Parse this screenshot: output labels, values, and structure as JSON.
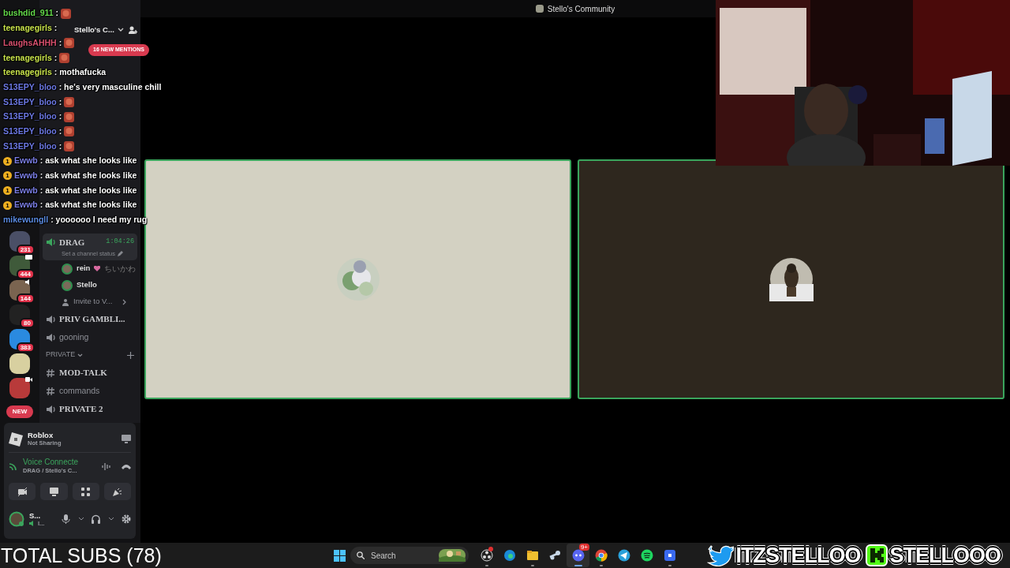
{
  "title_bar": {
    "title": "Stello's Community"
  },
  "server_header": {
    "name": "Stello's C...",
    "mentions": "16 NEW MENTIONS"
  },
  "chat": [
    {
      "user": "bushdid_911",
      "color": "#63d84a",
      "message": ":",
      "emote": true
    },
    {
      "user": "teenagegirls",
      "color": "#c6e04a",
      "message": ":"
    },
    {
      "user": "LaughsAHHH",
      "color": "#d8506e",
      "message": ":",
      "emote": true
    },
    {
      "user": "teenagegirls",
      "color": "#c6e04a",
      "message": ":",
      "emote": true
    },
    {
      "user": "teenagegirls",
      "color": "#c6e04a",
      "message": ": mothafucka"
    },
    {
      "user": "S13EPY_bloo",
      "color": "#6c78e4",
      "message": ": he's very masculine chill"
    },
    {
      "user": "S13EPY_bloo",
      "color": "#6c78e4",
      "message": ":",
      "emote": true
    },
    {
      "user": "S13EPY_bloo",
      "color": "#6c78e4",
      "message": ":",
      "emote": true
    },
    {
      "user": "S13EPY_bloo",
      "color": "#6c78e4",
      "message": ":",
      "emote": true
    },
    {
      "user": "S13EPY_bloo",
      "color": "#6c78e4",
      "message": ":",
      "emote": true
    },
    {
      "user": "Ewwb",
      "color": "#7b7ee6",
      "badge": "1",
      "message": ": ask what she looks like"
    },
    {
      "user": "Ewwb",
      "color": "#7b7ee6",
      "badge": "1",
      "message": ": ask what she looks like"
    },
    {
      "user": "Ewwb",
      "color": "#7b7ee6",
      "badge": "1",
      "message": ": ask what she looks like"
    },
    {
      "user": "Ewwb",
      "color": "#7b7ee6",
      "badge": "1",
      "message": ": ask what she looks like"
    },
    {
      "user": "mikewungll",
      "color": "#5a8ae0",
      "message": ": yoooooo I need my rug"
    }
  ],
  "server_rail": [
    {
      "color": "#4a4f66",
      "badge": "231",
      "screen_sharing": false,
      "in_voice": false,
      "camera_on": false
    },
    {
      "color": "#3f5a3a",
      "badge": "444",
      "screen_sharing": true,
      "in_voice": false,
      "camera_on": false
    },
    {
      "color": "#7a6450",
      "badge": "144",
      "screen_sharing": false,
      "in_voice": true,
      "camera_on": false
    },
    {
      "color": "#222222",
      "badge": "80",
      "screen_sharing": false,
      "in_voice": false,
      "camera_on": false
    },
    {
      "color": "#2a8ae0",
      "badge": "383",
      "screen_sharing": false,
      "in_voice": false,
      "camera_on": false
    },
    {
      "color": "#d8d0a0",
      "screen_sharing": false,
      "in_voice": false,
      "camera_on": false
    },
    {
      "color": "#b83a3a",
      "screen_sharing": false,
      "in_voice": false,
      "camera_on": true
    }
  ],
  "new_pill": "NEW",
  "channels": [
    {
      "kind": "voice",
      "name": "DRAG",
      "unread": true,
      "selected": true,
      "timer": "1:04:26",
      "status": "Set a channel status",
      "members": [
        {
          "name": "rein",
          "tag": "ちいかわ"
        },
        {
          "name": "Stello"
        }
      ],
      "invite": "Invite to V..."
    },
    {
      "kind": "voice",
      "name": "PRIV GAMBLI...",
      "unread": true,
      "selected": false
    },
    {
      "kind": "voice",
      "name": "gooning",
      "unread": false,
      "selected": false
    },
    {
      "kind": "category",
      "name": "PRIVATE"
    },
    {
      "kind": "text",
      "name": "MOD-TALK",
      "unread": true,
      "selected": false
    },
    {
      "kind": "text",
      "name": "commands",
      "unread": false,
      "selected": false
    },
    {
      "kind": "voice",
      "name": "PRIVATE 2",
      "unread": true,
      "selected": false
    }
  ],
  "activity": {
    "app": "Roblox",
    "status": "Not Sharing"
  },
  "voice": {
    "label": "Voice Connecte",
    "channel": "DRAG / Stello's C..."
  },
  "user": {
    "name": "S...",
    "status": "l..."
  },
  "video_tiles": [
    {
      "color": "#d3d1c2",
      "speaking": true
    },
    {
      "color": "#2e271e",
      "speaking": true
    }
  ],
  "taskbar": {
    "subs": "TOTAL SUBS (78)",
    "search": {
      "placeholder": "Search"
    },
    "apps": [
      {
        "kind": "obs",
        "running": true,
        "selected": false,
        "notification": true
      },
      {
        "kind": "edge",
        "running": false,
        "selected": false
      },
      {
        "kind": "folder",
        "running": true,
        "selected": false
      },
      {
        "kind": "steam",
        "running": false,
        "selected": false
      },
      {
        "kind": "discord",
        "running": true,
        "selected": true,
        "badge": "9+"
      },
      {
        "kind": "chrome",
        "running": true,
        "selected": false
      },
      {
        "kind": "telegram",
        "running": false,
        "selected": false
      },
      {
        "kind": "spotify",
        "running": false,
        "selected": false
      },
      {
        "kind": "roblox",
        "running": true,
        "selected": false
      }
    ]
  },
  "socials": [
    {
      "kind": "twitter",
      "handle": "ITZSTELLOO"
    },
    {
      "kind": "kick",
      "handle": "STELLOOO"
    }
  ]
}
